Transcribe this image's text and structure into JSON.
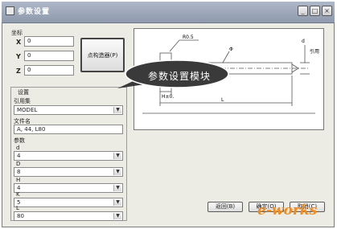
{
  "window": {
    "title": "参数设置",
    "buttons": {
      "minimize": "_",
      "maximize": "□",
      "close": "×"
    }
  },
  "coords": {
    "group_label": "坐标",
    "fields": [
      {
        "letter": "X",
        "value": "0"
      },
      {
        "letter": "Y",
        "value": "0"
      },
      {
        "letter": "Z",
        "value": "0"
      }
    ]
  },
  "point_selector_button": "点构造器(P)",
  "callout": "参数设置模块",
  "settings": {
    "group_label": "设置",
    "reference_set_label": "引用集",
    "reference_set_value": "MODEL",
    "file_name_label": "文件名",
    "file_name_value": "A, 44, L80",
    "params_label": "参数",
    "params": [
      {
        "label": "d",
        "value": "4"
      },
      {
        "label": "D",
        "value": "8"
      },
      {
        "label": "H",
        "value": "4"
      },
      {
        "label": "K",
        "value": "5"
      },
      {
        "label": "L",
        "value": "80"
      }
    ]
  },
  "drawing": {
    "labels": {
      "r05": "R0.5",
      "dia": "Φ",
      "d": "d",
      "h": "H±0.",
      "l": "L",
      "note": "引用"
    }
  },
  "footer": {
    "back": "返回(B)",
    "ok": "确定(O)",
    "cancel": "取消(C)"
  },
  "watermark": "e-works"
}
